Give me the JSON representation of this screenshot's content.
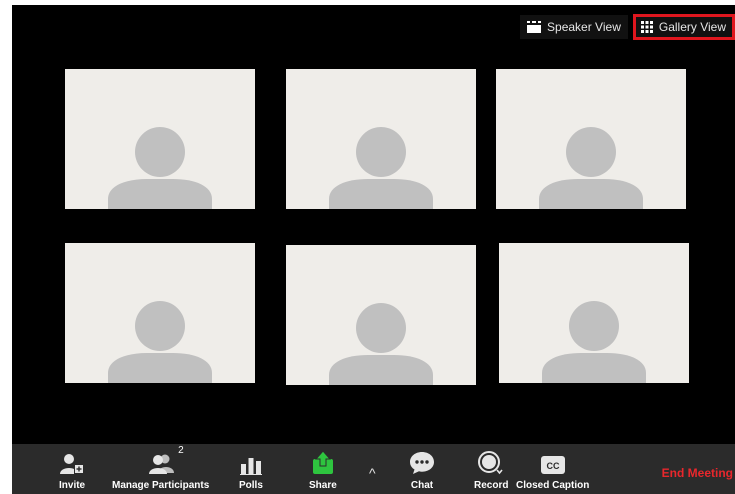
{
  "view_switch": {
    "speaker_label": "Speaker View",
    "gallery_label": "Gallery View",
    "active": "gallery"
  },
  "participants": [
    {
      "id": 1
    },
    {
      "id": 2
    },
    {
      "id": 3
    },
    {
      "id": 4
    },
    {
      "id": 5
    },
    {
      "id": 6
    }
  ],
  "toolbar": {
    "invite": "Invite",
    "manage_participants": "Manage Participants",
    "participant_count": "2",
    "polls": "Polls",
    "share": "Share",
    "chat": "Chat",
    "record": "Record",
    "closed_caption": "Closed Caption",
    "cc_icon_text": "CC",
    "end_meeting": "End Meeting"
  },
  "colors": {
    "background": "#000000",
    "toolbar": "#2b2b2b",
    "highlight": "#e0161e",
    "share": "#2ec53f",
    "end_meeting": "#e8272c",
    "tile": "#efede9",
    "avatar": "#c0c0c0"
  }
}
